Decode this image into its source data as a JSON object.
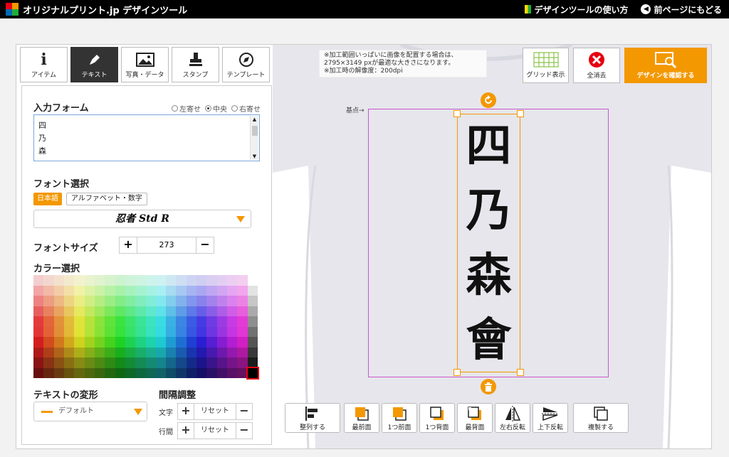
{
  "header": {
    "site_title": "オリジナルプリント.jp デザインツール",
    "help_link": "デザインツールの使い方",
    "back_link": "前ページにもどる"
  },
  "tabs": [
    {
      "label": "アイテム",
      "icon": "info-icon"
    },
    {
      "label": "テキスト",
      "icon": "pen-icon",
      "active": true
    },
    {
      "label": "写真・データ",
      "icon": "image-icon"
    },
    {
      "label": "スタンプ",
      "icon": "stamp-icon"
    },
    {
      "label": "テンプレート",
      "icon": "compass-icon"
    }
  ],
  "panel": {
    "input_form_title": "入力フォーム",
    "align": {
      "left": "左寄せ",
      "center": "中央",
      "right": "右寄せ",
      "selected": "中央"
    },
    "text_lines": [
      "四",
      "乃",
      "森"
    ],
    "font_title": "フォント選択",
    "font_jp_button": "日本語",
    "font_alpha_button": "アルファベット・数字",
    "font_selected": "忍者 Std R",
    "size_title": "フォントサイズ",
    "size_value": "273",
    "size_plus": "+",
    "size_minus": "−",
    "color_title": "カラー選択",
    "transform_title": "テキストの変形",
    "transform_value": "デフォルト",
    "spacing_title": "間隔調整",
    "spacing_char_label": "文字",
    "spacing_line_label": "行間",
    "reset_label": "リセット"
  },
  "canvas": {
    "note_lines": [
      "※加工範囲いっぱいに画像を配置する場合は、",
      "2795×3149 pxが最適な大きさになります。",
      "※加工時の解像度：200dpi"
    ],
    "base_label": "基点→",
    "design_text": [
      "四",
      "乃",
      "森",
      "會"
    ]
  },
  "toolbar": {
    "grid_label": "グリッド表示",
    "clear_label": "全消去",
    "confirm_label": "デザインを確認する"
  },
  "bottom_bar": {
    "align_label": "整列する",
    "front_most": "最前面",
    "forward_one": "1つ前面",
    "backward_one": "1つ背面",
    "back_most": "最背面",
    "flip_h": "左右反転",
    "flip_v": "上下反転",
    "duplicate": "複製する"
  },
  "colors": {
    "accent": "#f39800",
    "print_area": "#cc55cc",
    "header_bg": "#000000"
  }
}
